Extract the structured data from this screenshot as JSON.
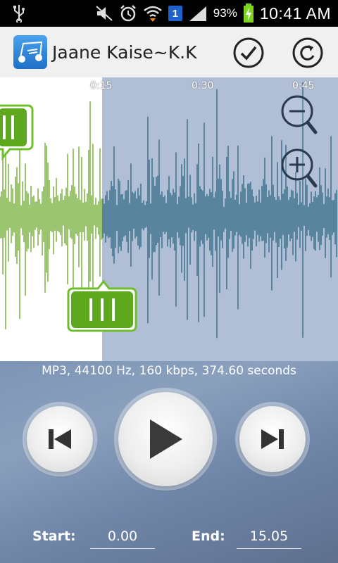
{
  "status_bar": {
    "battery_percent": "93%",
    "notification_count": "1",
    "time": "10:41 AM",
    "icons": [
      "usb-icon",
      "mute-icon",
      "alarm-icon",
      "wifi-icon",
      "sim-badge-icon",
      "signal-icon",
      "battery-icon"
    ]
  },
  "action_bar": {
    "title": "Jaane Kaise~K.K",
    "icons": [
      "app-icon",
      "check-icon",
      "revert-icon"
    ]
  },
  "waveform": {
    "timeline_labels": [
      "0:15",
      "0:30",
      "0:45"
    ],
    "selected_color": "#5a9e12",
    "unselected_color": "#1f5e78",
    "unselected_bg": "#b0bed6",
    "icons": [
      "zoom-out-icon",
      "zoom-in-icon",
      "start-handle-icon",
      "end-handle-icon"
    ]
  },
  "controls": {
    "file_info": "MP3, 44100 Hz, 160 kbps, 374.60 seconds",
    "start_label": "Start:",
    "start_value": "0.00",
    "end_label": "End:",
    "end_value": "15.05",
    "icons": [
      "previous-icon",
      "play-icon",
      "next-icon"
    ]
  }
}
